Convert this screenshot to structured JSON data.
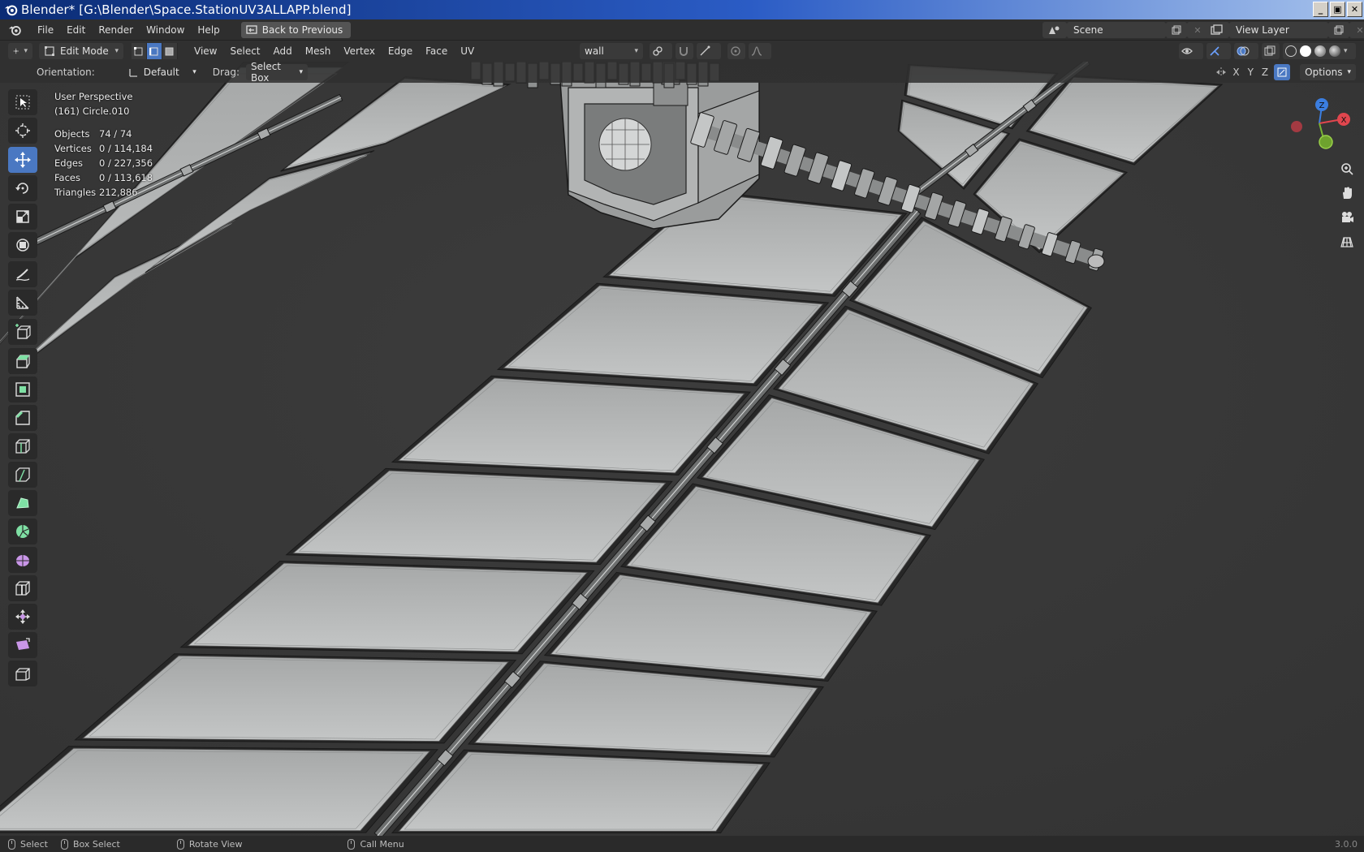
{
  "window": {
    "title": "Blender* [G:\\Blender\\Space.StationUV3ALLAPP.blend]",
    "buttons": [
      "minimize",
      "restore",
      "close"
    ]
  },
  "menubar": {
    "items": [
      "File",
      "Edit",
      "Render",
      "Window",
      "Help"
    ],
    "back_button": "Back to Previous",
    "scene": "Scene",
    "view_layer": "View Layer"
  },
  "viewport_header": {
    "mode": "Edit Mode",
    "menus": [
      "View",
      "Select",
      "Add",
      "Mesh",
      "Vertex",
      "Edge",
      "Face",
      "UV"
    ],
    "material_slot": "wall",
    "select_mode_active": "edge"
  },
  "tool_settings": {
    "orientation_label": "Orientation:",
    "orientation_value": "Default",
    "drag_label": "Drag:",
    "drag_value": "Select Box",
    "axes": [
      "X",
      "Y",
      "Z"
    ],
    "options": "Options"
  },
  "overlay": {
    "view_name": "User Perspective",
    "object_name": "(161) Circle.010",
    "stats": [
      {
        "label": "Objects",
        "value": "74 / 74"
      },
      {
        "label": "Vertices",
        "value": "0 / 114,184"
      },
      {
        "label": "Edges",
        "value": "0 / 227,356"
      },
      {
        "label": "Faces",
        "value": "0 / 113,618"
      },
      {
        "label": "Triangles",
        "value": "212,886"
      }
    ]
  },
  "gizmo": {
    "x": "X",
    "z": "Z"
  },
  "toolbar": {
    "active_tool": "move",
    "tools": [
      "select-box",
      "cursor",
      "move",
      "rotate",
      "scale",
      "transform",
      "annotate",
      "measure",
      "add-cube",
      "extrude-region",
      "inset-faces",
      "bevel",
      "loop-cut",
      "knife",
      "poly-build",
      "spin",
      "smooth",
      "edge-slide",
      "shrink-fatten",
      "shear",
      "rip-region"
    ]
  },
  "statusbar": {
    "select": "Select",
    "box_select": "Box Select",
    "rotate_view": "Rotate View",
    "call_menu": "Call Menu",
    "version": "3.0.0"
  },
  "colors": {
    "accent": "#4a78c2",
    "viewport_bg": "#393939",
    "panel": "#b4b6b6"
  }
}
